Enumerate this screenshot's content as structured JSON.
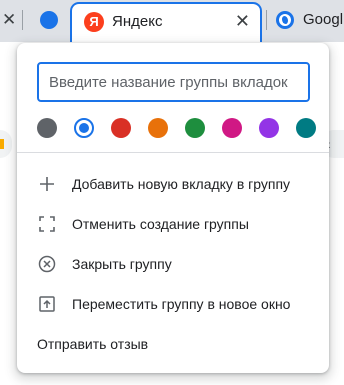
{
  "tabstrip": {
    "group_color": "#1a73e8",
    "tabs": [
      {
        "title": "Яндекс",
        "favicon": "yandex-icon",
        "favicon_glyph": "Я",
        "active": true
      },
      {
        "title": "Googl",
        "favicon": "globe-icon",
        "active": false
      }
    ],
    "close_glyph": "✕"
  },
  "background": {
    "right_ext_glyph": "‹"
  },
  "popup": {
    "name_input": {
      "value": "",
      "placeholder": "Введите название группы вкладок"
    },
    "colors": [
      {
        "name": "grey",
        "hex": "#5f6368",
        "selected": false
      },
      {
        "name": "blue",
        "hex": "#1a73e8",
        "selected": true
      },
      {
        "name": "red",
        "hex": "#d93025",
        "selected": false
      },
      {
        "name": "orange",
        "hex": "#e8710a",
        "selected": false
      },
      {
        "name": "green",
        "hex": "#1e8e3e",
        "selected": false
      },
      {
        "name": "pink",
        "hex": "#d01884",
        "selected": false
      },
      {
        "name": "purple",
        "hex": "#9334e6",
        "selected": false
      },
      {
        "name": "cyan",
        "hex": "#007b83",
        "selected": false
      }
    ],
    "menu": {
      "add_tab": {
        "icon": "plus-icon",
        "label": "Добавить новую вкладку в группу"
      },
      "ungroup": {
        "icon": "ungroup-icon",
        "label": "Отменить создание группы"
      },
      "close_group": {
        "icon": "close-circle-icon",
        "label": "Закрыть группу"
      },
      "move_group": {
        "icon": "move-window-icon",
        "label": "Переместить группу в новое окно"
      },
      "feedback": {
        "label": "Отправить отзыв"
      }
    }
  }
}
